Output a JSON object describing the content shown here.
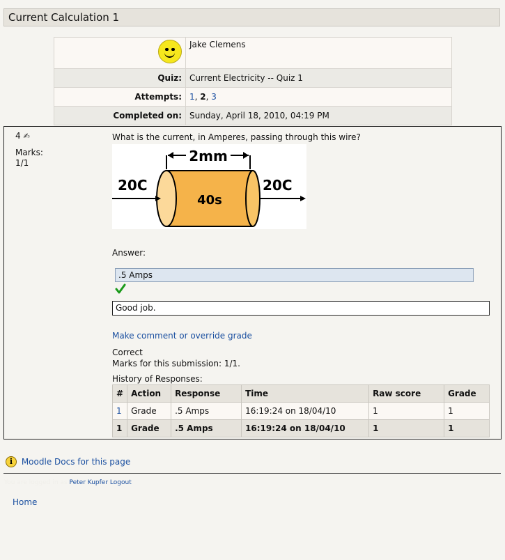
{
  "page": {
    "title": "Current Calculation 1"
  },
  "user": {
    "name": "Jake Clemens"
  },
  "info": {
    "quiz_label": "Quiz:",
    "quiz_value": "Current Electricity -- Quiz 1",
    "attempts_label": "Attempts:",
    "attempts": [
      "1",
      "2",
      "3"
    ],
    "attempts_current": "2",
    "completed_label": "Completed on:",
    "completed_value": "Sunday, April 18, 2010, 04:19 PM"
  },
  "question": {
    "number": "4",
    "marks_label": "Marks:",
    "marks_value": "1/1",
    "text": "What is the current, in Amperes, passing through this wire?",
    "diagram": {
      "width_label": "2mm",
      "left_charge": "20C",
      "right_charge": "20C",
      "time_label": "40s"
    },
    "answer_label": "Answer:",
    "answer_value": ".5 Amps",
    "feedback": "Good job.",
    "override_link": "Make comment or override grade",
    "status": "Correct",
    "marks_submission": "Marks for this submission: 1/1."
  },
  "history": {
    "title": "History of Responses:",
    "columns": [
      "#",
      "Action",
      "Response",
      "Time",
      "Raw score",
      "Grade"
    ],
    "rows": [
      {
        "num": "1",
        "action": "Grade",
        "response": ".5 Amps",
        "time": "16:19:24 on 18/04/10",
        "raw": "1",
        "grade": "1"
      },
      {
        "num": "1",
        "action": "Grade",
        "response": ".5 Amps",
        "time": "16:19:24 on 18/04/10",
        "raw": "1",
        "grade": "1"
      }
    ]
  },
  "footer": {
    "docs_link": "Moodle Docs for this page",
    "logged_in_prefix": "You are logged in as",
    "user_link": "Peter Kupfer",
    "logout_link": "Logout",
    "home_link": "Home"
  },
  "colors": {
    "link": "#1a4fa0",
    "check": "#1a9a1a",
    "cylinder": "#f5b34a"
  }
}
